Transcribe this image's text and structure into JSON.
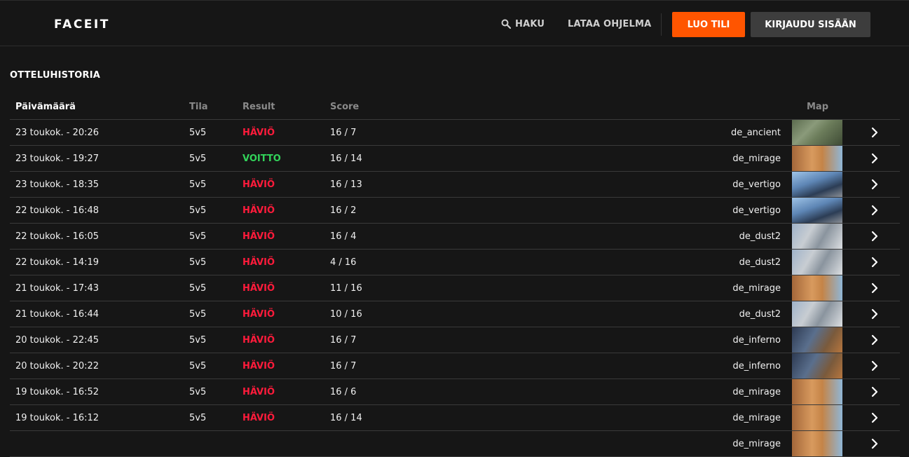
{
  "header": {
    "logo_text": "FACEIT",
    "search_label": "HAKU",
    "download_label": "LATAA OHJELMA",
    "signup_label": "LUO TILI",
    "login_label": "KIRJAUDU SISÄÄN",
    "accent_color": "#ff5500"
  },
  "section_title": "OTTELUHISTORIA",
  "table": {
    "columns": {
      "date": "Päivämäärä",
      "mode": "Tila",
      "result": "Result",
      "score": "Score",
      "map": "Map"
    },
    "rows": [
      {
        "date": "23 toukok. - 20:26",
        "mode": "5v5",
        "result": "HÄVIÖ",
        "outcome": "loss",
        "score": "16 / 7",
        "map": "de_ancient"
      },
      {
        "date": "23 toukok. - 19:27",
        "mode": "5v5",
        "result": "VOITTO",
        "outcome": "win",
        "score": "16 / 14",
        "map": "de_mirage"
      },
      {
        "date": "23 toukok. - 18:35",
        "mode": "5v5",
        "result": "HÄVIÖ",
        "outcome": "loss",
        "score": "16 / 13",
        "map": "de_vertigo"
      },
      {
        "date": "22 toukok. - 16:48",
        "mode": "5v5",
        "result": "HÄVIÖ",
        "outcome": "loss",
        "score": "16 / 2",
        "map": "de_vertigo"
      },
      {
        "date": "22 toukok. - 16:05",
        "mode": "5v5",
        "result": "HÄVIÖ",
        "outcome": "loss",
        "score": "16 / 4",
        "map": "de_dust2"
      },
      {
        "date": "22 toukok. - 14:19",
        "mode": "5v5",
        "result": "HÄVIÖ",
        "outcome": "loss",
        "score": "4 / 16",
        "map": "de_dust2"
      },
      {
        "date": "21 toukok. - 17:43",
        "mode": "5v5",
        "result": "HÄVIÖ",
        "outcome": "loss",
        "score": "11 / 16",
        "map": "de_mirage"
      },
      {
        "date": "21 toukok. - 16:44",
        "mode": "5v5",
        "result": "HÄVIÖ",
        "outcome": "loss",
        "score": "10 / 16",
        "map": "de_dust2"
      },
      {
        "date": "20 toukok. - 22:45",
        "mode": "5v5",
        "result": "HÄVIÖ",
        "outcome": "loss",
        "score": "16 / 7",
        "map": "de_inferno"
      },
      {
        "date": "20 toukok. - 20:22",
        "mode": "5v5",
        "result": "HÄVIÖ",
        "outcome": "loss",
        "score": "16 / 7",
        "map": "de_inferno"
      },
      {
        "date": "19 toukok. - 16:52",
        "mode": "5v5",
        "result": "HÄVIÖ",
        "outcome": "loss",
        "score": "16 / 6",
        "map": "de_mirage"
      },
      {
        "date": "19 toukok. - 16:12",
        "mode": "5v5",
        "result": "HÄVIÖ",
        "outcome": "loss",
        "score": "16 / 14",
        "map": "de_mirage"
      },
      {
        "date": "",
        "mode": "",
        "result": "",
        "outcome": "loss",
        "score": "",
        "map": "de_mirage"
      }
    ]
  }
}
